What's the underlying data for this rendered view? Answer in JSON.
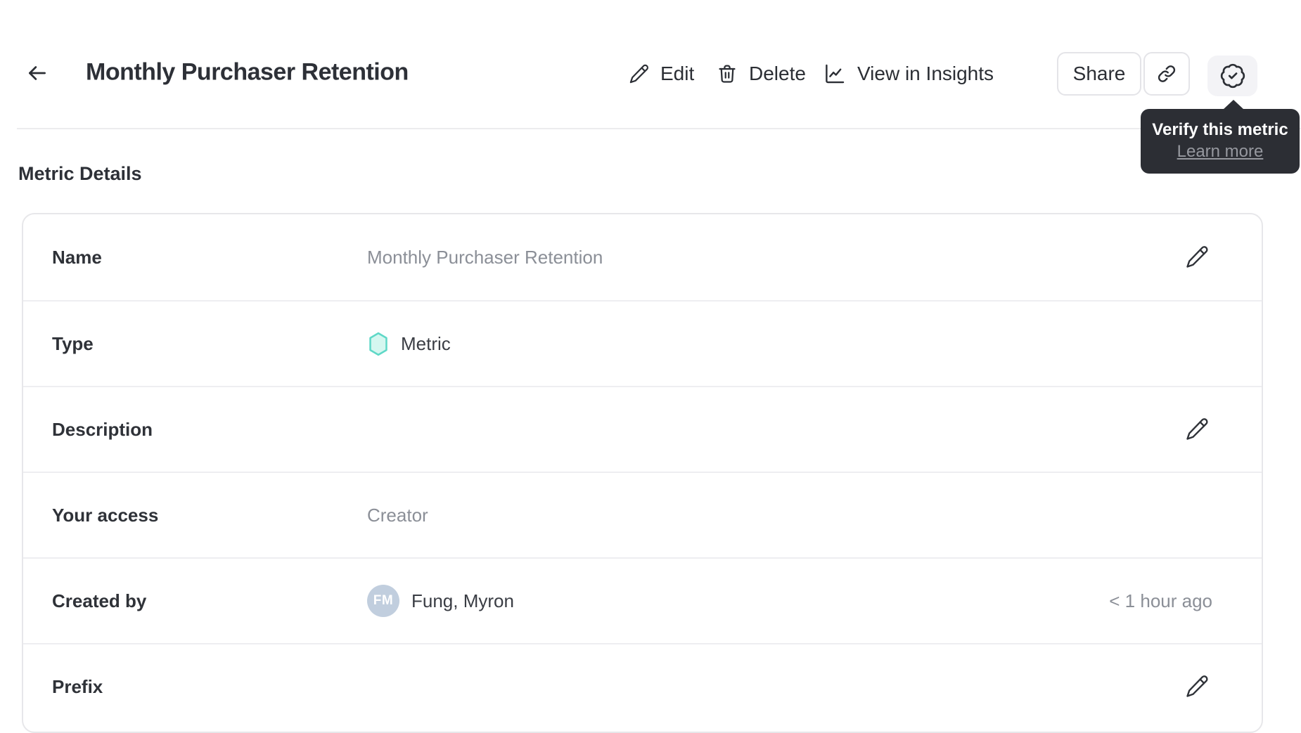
{
  "header": {
    "title": "Monthly Purchaser Retention",
    "actions": {
      "edit": "Edit",
      "delete": "Delete",
      "view_in_insights": "View in Insights",
      "share": "Share"
    }
  },
  "verify_tooltip": {
    "title": "Verify this metric",
    "link_label": "Learn more"
  },
  "metric_details": {
    "heading": "Metric Details",
    "rows": [
      {
        "label": "Name",
        "kind": "text",
        "value": "Monthly Purchaser Retention",
        "muted": true,
        "editable": true
      },
      {
        "label": "Type",
        "kind": "metric-type",
        "value": "Metric",
        "icon": "metric-hexagon-icon",
        "editable": false
      },
      {
        "label": "Description",
        "kind": "text",
        "value": "",
        "editable": true
      },
      {
        "label": "Your access",
        "kind": "text",
        "value": "Creator",
        "muted": true,
        "editable": false
      },
      {
        "label": "Created by",
        "kind": "user",
        "value": "Fung, Myron",
        "avatar_initials": "FM",
        "timestamp": "< 1 hour ago",
        "editable": false
      },
      {
        "label": "Prefix",
        "kind": "text",
        "value": "",
        "editable": true
      }
    ]
  },
  "colors": {
    "accent_teal": "#5fd8c7",
    "accent_teal_fill": "#d5f7f0",
    "tooltip_bg": "#2c2e34",
    "avatar_bg": "#c1cede",
    "text_dark": "#30333a",
    "text_muted": "#8b8f97",
    "badge_button_bg": "#f3f3f6"
  }
}
